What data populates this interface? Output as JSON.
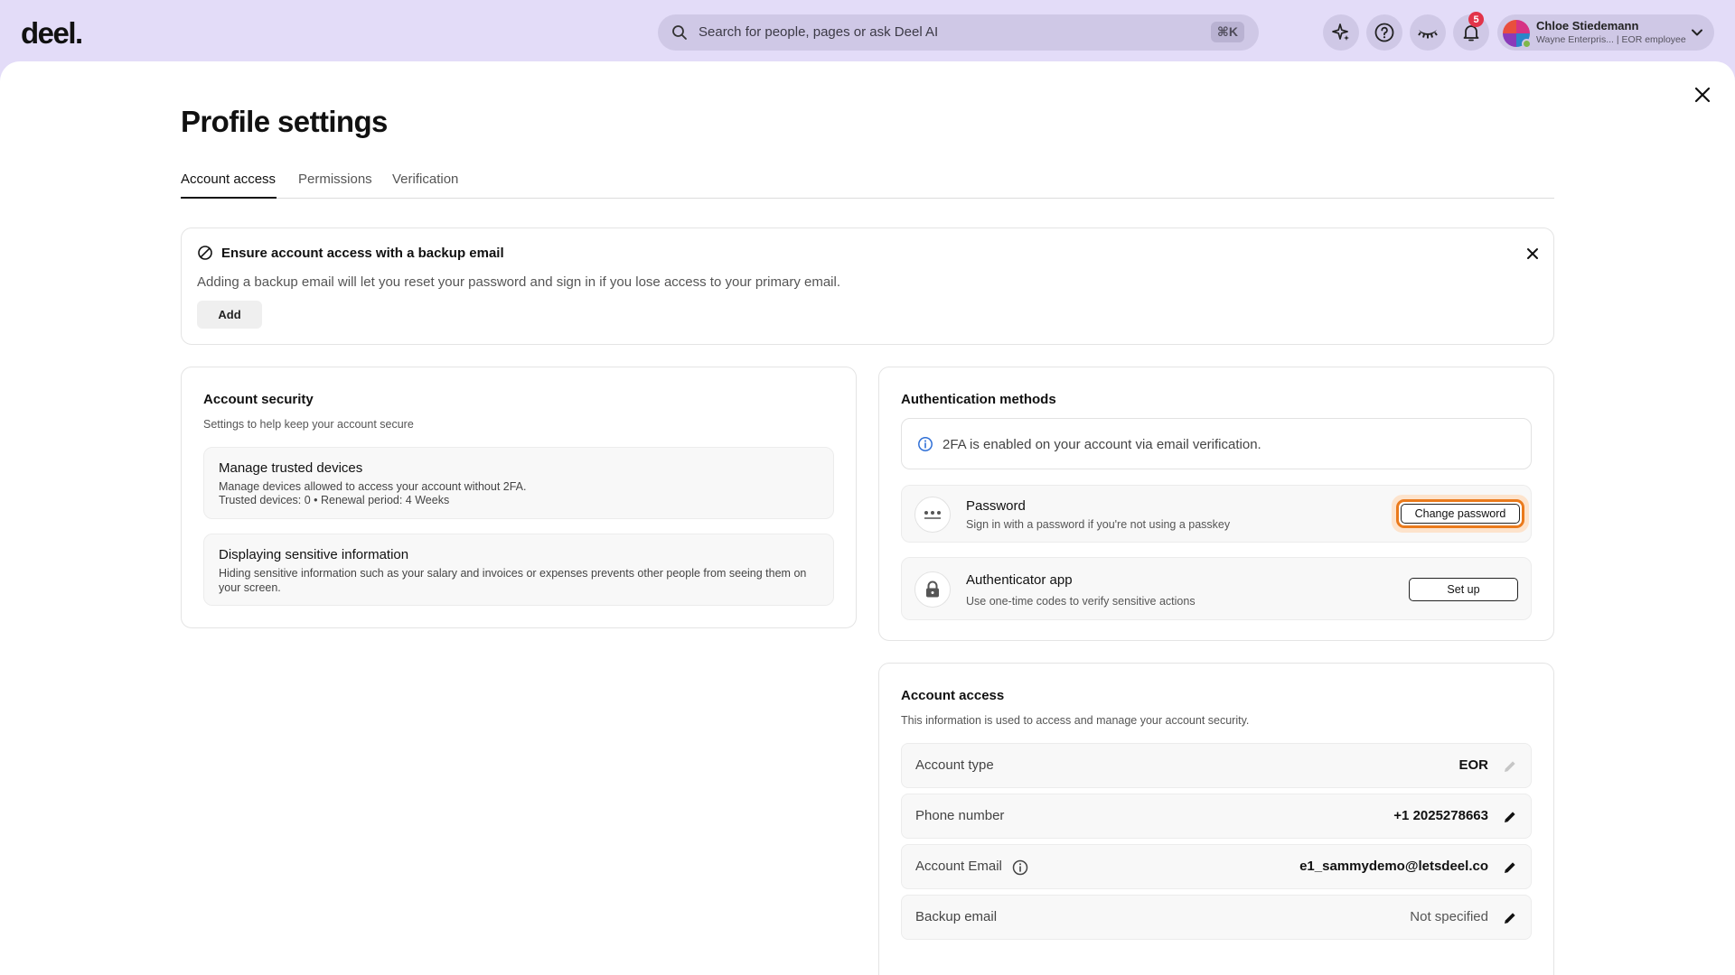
{
  "brand": {
    "logo_text": "deel."
  },
  "search": {
    "placeholder": "Search for people, pages or ask Deel AI",
    "shortcut": "⌘K"
  },
  "topbar": {
    "notification_count": "5"
  },
  "user": {
    "name": "Chloe Stiedemann",
    "subtitle": "Wayne Enterpris... | EOR employee"
  },
  "page": {
    "title": "Profile settings"
  },
  "tabs": [
    {
      "label": "Account access",
      "active": true
    },
    {
      "label": "Permissions",
      "active": false
    },
    {
      "label": "Verification",
      "active": false
    }
  ],
  "banner": {
    "title": "Ensure account access with a backup email",
    "description": "Adding a backup email will let you reset your password and sign in if you lose access to your primary email.",
    "add_label": "Add"
  },
  "account_security": {
    "title": "Account security",
    "subtitle": "Settings to help keep your account secure",
    "items": [
      {
        "title": "Manage trusted devices",
        "description": "Manage devices allowed to access your account without 2FA.",
        "detail": "Trusted devices: 0 • Renewal period: 4 Weeks"
      },
      {
        "title": "Displaying sensitive information",
        "description": "Hiding sensitive information such as your salary and invoices or expenses prevents other people from seeing them on your screen."
      }
    ]
  },
  "auth_methods": {
    "title": "Authentication methods",
    "info": "2FA is enabled on your account via email verification.",
    "methods": [
      {
        "title": "Password",
        "description": "Sign in with a password if you're not using a passkey",
        "action": "Change password"
      },
      {
        "title": "Authenticator app",
        "description": "Use one-time codes to verify sensitive actions",
        "action": "Set up"
      }
    ]
  },
  "account_access": {
    "title": "Account access",
    "subtitle": "This information is used to access and manage your account security.",
    "rows": [
      {
        "label": "Account type",
        "value": "EOR"
      },
      {
        "label": "Phone number",
        "value": "+1 2025278663"
      },
      {
        "label": "Account Email",
        "value": "e1_sammydemo@letsdeel.co"
      },
      {
        "label": "Backup email",
        "value": "Not specified"
      }
    ]
  },
  "colors": {
    "topbar_bg": "#e3dcf8",
    "accent_focus": "#ea7a1c",
    "badge": "#e2344a",
    "info": "#2f6fd6"
  }
}
